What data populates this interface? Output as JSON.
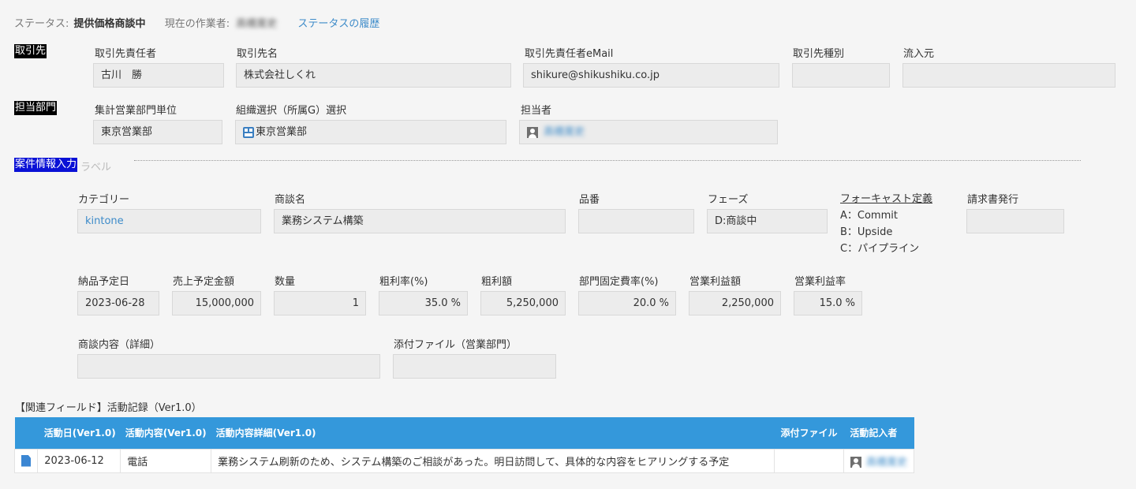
{
  "status_bar": {
    "status_label": "ステータス:",
    "status_value": "提供価格商談中",
    "worker_label": "現在の作業者:",
    "worker_value": "高橋寛史",
    "history_link": "ステータスの履歴"
  },
  "client": {
    "section_tag": "取引先",
    "contact_person_label": "取引先責任者",
    "contact_person_value": "古川　勝",
    "company_name_label": "取引先名",
    "company_name_value": "株式会社しくれ",
    "email_label": "取引先責任者eMail",
    "email_value": "shikure@shikushiku.co.jp",
    "client_type_label": "取引先種別",
    "client_type_value": "",
    "source_label": "流入元",
    "source_value": ""
  },
  "department": {
    "section_tag": "担当部門",
    "sales_unit_label": "集計営業部門単位",
    "sales_unit_value": "東京営業部",
    "org_select_label": "組織選択（所属G）選択",
    "org_select_value": "東京営業部",
    "assignee_label": "担当者",
    "assignee_value": "高橋寛史"
  },
  "deal": {
    "section_tag": "案件情報入力",
    "section_tag_overflow": "ラベル",
    "category_label": "カテゴリー",
    "category_value": "kintone",
    "deal_name_label": "商談名",
    "deal_name_value": "業務システム構築",
    "part_no_label": "品番",
    "part_no_value": "",
    "phase_label": "フェーズ",
    "phase_value": "D:商談中",
    "forecast_title": "フォーキャスト定義",
    "forecast_items": [
      "A：Commit",
      "B：Upside",
      "C：パイプライン"
    ],
    "invoice_label": "請求書発行",
    "invoice_value": ""
  },
  "figures": {
    "delivery_date_label": "納品予定日",
    "delivery_date_value": "2023-06-28",
    "sales_amount_label": "売上予定金額",
    "sales_amount_value": "15,000,000",
    "quantity_label": "数量",
    "quantity_value": "1",
    "gross_margin_rate_label": "粗利率(%)",
    "gross_margin_rate_value": "35.0 %",
    "gross_profit_label": "粗利額",
    "gross_profit_value": "5,250,000",
    "fixed_cost_rate_label": "部門固定費率(%)",
    "fixed_cost_rate_value": "20.0 %",
    "operating_profit_label": "営業利益額",
    "operating_profit_value": "2,250,000",
    "operating_margin_label": "営業利益率",
    "operating_margin_value": "15.0 %"
  },
  "details": {
    "deal_detail_label": "商談内容（詳細）",
    "deal_detail_value": "",
    "attachment_label": "添付ファイル（営業部門）",
    "attachment_value": ""
  },
  "related": {
    "title": "【関連フィールド】活動記録（Ver1.0）",
    "columns": [
      "活動日(Ver1.0)",
      "活動内容(Ver1.0)",
      "活動内容詳細(Ver1.0)",
      "添付ファイル",
      "活動記入者"
    ],
    "rows": [
      {
        "date": "2023-06-12",
        "type": "電話",
        "detail": "業務システム刷新のため、システム構築のご相談があった。明日訪問して、具体的な内容をヒアリングする予定",
        "attachment": "",
        "recorder": "高橋寛史"
      }
    ]
  },
  "colors": {
    "table_header_bg": "#3498db",
    "link": "#3d8bc9",
    "deal_tag_bg": "#0a11d6",
    "section_tag_bg": "#000000"
  }
}
